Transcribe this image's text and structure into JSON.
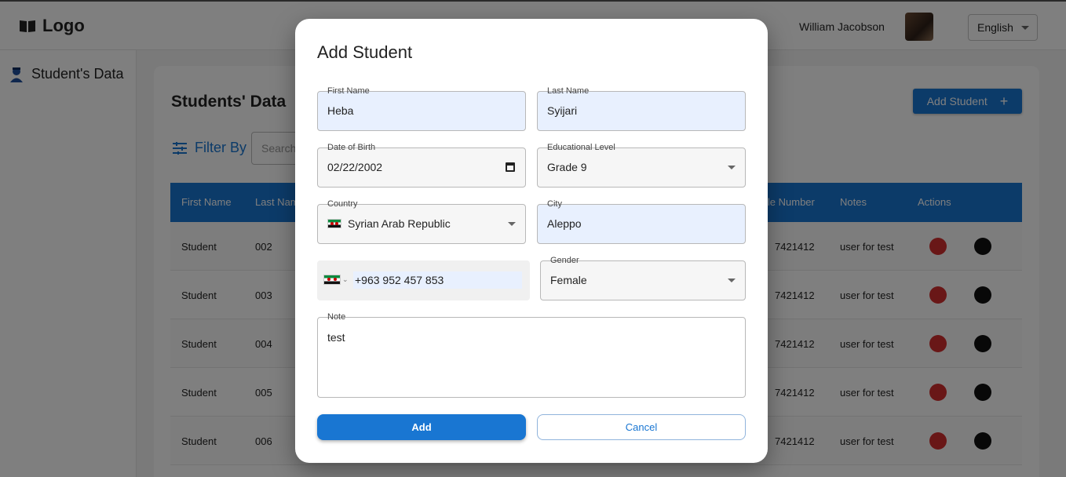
{
  "header": {
    "logo_text": "Logo",
    "user_name": "William Jacobson",
    "language": "English"
  },
  "sidebar": {
    "items": [
      {
        "label": "Student's Data",
        "icon": "student-icon"
      }
    ]
  },
  "main": {
    "title": "Students' Data",
    "add_button": "Add Student",
    "filter_label": "Filter By",
    "search_placeholder": "Search",
    "table": {
      "columns": [
        "First Name",
        "Last Name",
        "Mobile Number",
        "Notes",
        "Actions"
      ],
      "column_partial": {
        "last_name": "Last Nam",
        "mobile": "ile Number"
      },
      "rows": [
        {
          "first": "Student",
          "last": "002",
          "mobile": "7421412",
          "notes": "user for test"
        },
        {
          "first": "Student",
          "last": "003",
          "mobile": "7421412",
          "notes": "user for test"
        },
        {
          "first": "Student",
          "last": "004",
          "mobile": "7421412",
          "notes": "user for test"
        },
        {
          "first": "Student",
          "last": "005",
          "mobile": "7421412",
          "notes": "user for test"
        },
        {
          "first": "Student",
          "last": "006",
          "mobile": "7421412",
          "notes": "user for test"
        }
      ]
    }
  },
  "modal": {
    "title": "Add Student",
    "fields": {
      "first_name": {
        "label": "First Name",
        "value": "Heba"
      },
      "last_name": {
        "label": "Last Name",
        "value": "Syijari"
      },
      "dob": {
        "label": "Date of Birth",
        "value": "02/22/2002"
      },
      "education": {
        "label": "Educational Level",
        "value": "Grade 9"
      },
      "country": {
        "label": "Country",
        "value": "Syrian Arab Republic"
      },
      "city": {
        "label": "City",
        "value": "Aleppo"
      },
      "phone": {
        "value": "+963 952 457 853"
      },
      "gender": {
        "label": "Gender",
        "value": "Female"
      },
      "note": {
        "label": "Note",
        "value": "test"
      }
    },
    "add_label": "Add",
    "cancel_label": "Cancel"
  },
  "colors": {
    "primary": "#1976d2",
    "danger": "#d32f2f",
    "overlay": "rgba(0,0,0,0.5)"
  }
}
